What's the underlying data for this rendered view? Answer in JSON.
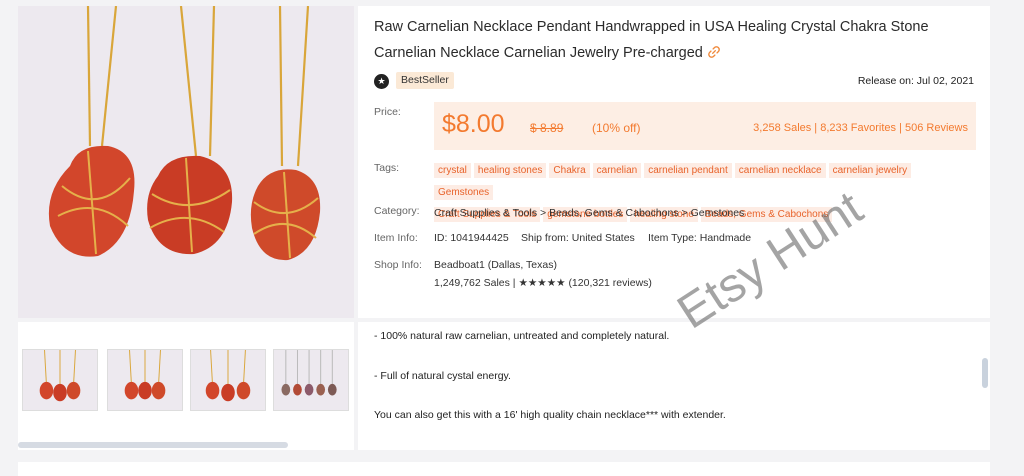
{
  "product": {
    "title": "Raw Carnelian Necklace Pendant Handwrapped in USA Healing Crystal Chakra Stone Carnelian Necklace Carnelian Jewelry Pre-charged",
    "link_icon": "link-icon",
    "seller_icon": "star-badge-icon",
    "badge": "BestSeller",
    "release": "Release on: Jul 02, 2021"
  },
  "labels": {
    "price": "Price:",
    "tags": "Tags:",
    "category": "Category:",
    "item_info": "Item Info:",
    "shop_info": "Shop Info:"
  },
  "price": {
    "current": "$8.00",
    "original": "$ 8.89",
    "discount": "(10% off)",
    "stats": "3,258 Sales | 8,233 Favorites | 506 Reviews"
  },
  "tags": [
    "crystal",
    "healing stones",
    "Chakra",
    "carnelian",
    "carnelian pendant",
    "carnelian necklace",
    "carnelian jewelry",
    "Gemstones",
    "Craft Supplies & Tools",
    "gemstone bottles",
    "healing stone",
    "Beads, Gems & Cabochons"
  ],
  "category": "Craft Supplies & Tools  > Beads, Gems & Cabochons > Gemstones",
  "item_info": {
    "id": "ID: 1041944425",
    "ship_from": "Ship from: United States",
    "type": "Item Type: Handmade"
  },
  "shop": {
    "name": "Beadboat1 (Dallas, Texas)",
    "stats": "1,249,762 Sales | ★★★★★ (120,321 reviews)"
  },
  "description": [
    "- 100% natural raw carnelian, untreated and completely natural.",
    "- Full of natural cystal energy.",
    "You can also get this with a 16' high quality chain necklace*** with extender."
  ],
  "watermark": "Etsy Hunt",
  "colors": {
    "accent": "#f37a2f",
    "price_bg": "#fdeee4",
    "tag_bg": "#fdece4",
    "stone": "#d2462b",
    "chain": "#d9a63a"
  }
}
